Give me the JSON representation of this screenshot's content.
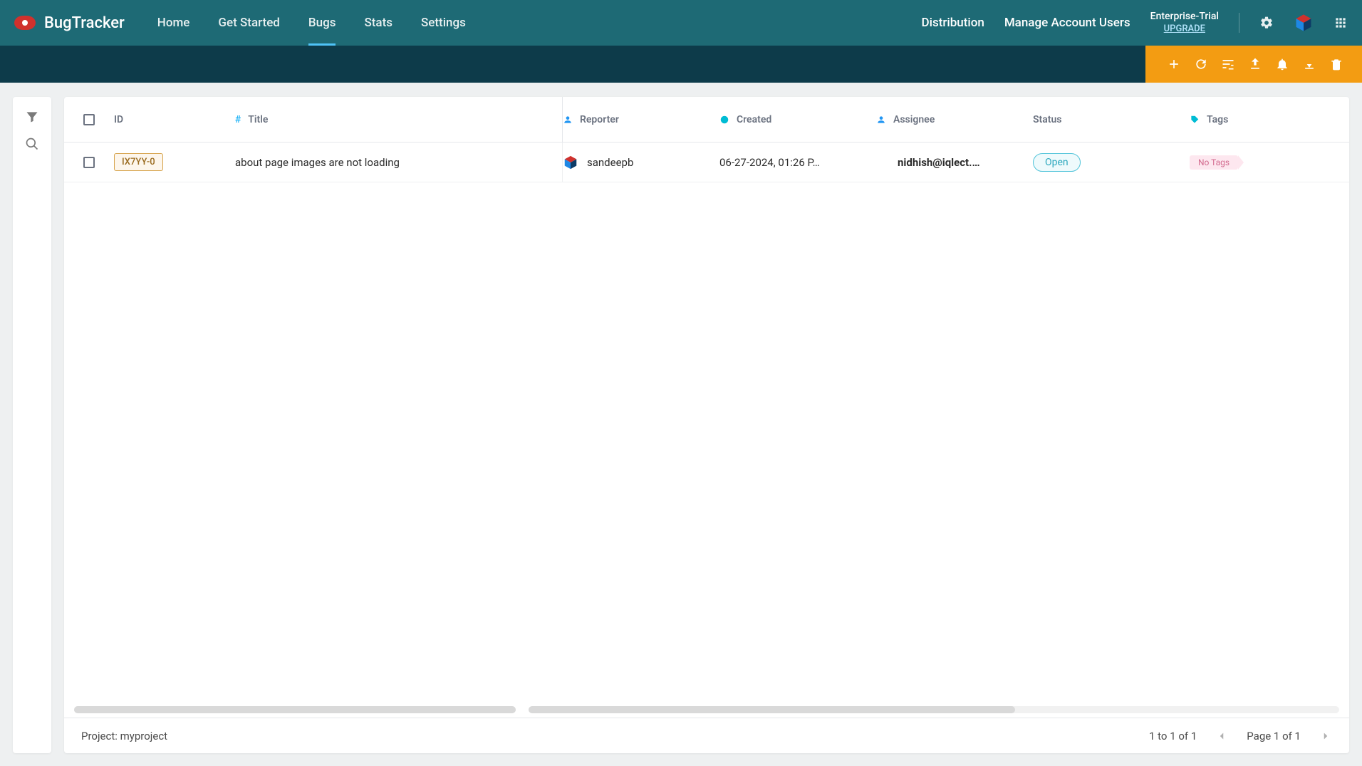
{
  "brand": "BugTracker",
  "nav": {
    "items": [
      {
        "label": "Home",
        "active": false
      },
      {
        "label": "Get Started",
        "active": false
      },
      {
        "label": "Bugs",
        "active": true
      },
      {
        "label": "Stats",
        "active": false
      },
      {
        "label": "Settings",
        "active": false
      }
    ],
    "right": {
      "distribution": "Distribution",
      "manage_users": "Manage Account Users",
      "trial_label": "Enterprise-Trial",
      "upgrade": "UPGRADE"
    }
  },
  "columns": {
    "id": "ID",
    "title": "Title",
    "reporter": "Reporter",
    "created": "Created",
    "assignee": "Assignee",
    "status": "Status",
    "tags": "Tags"
  },
  "rows": [
    {
      "id": "IX7YY-0",
      "title": "about page images are not loading",
      "reporter": "sandeepb",
      "created": "06-27-2024, 01:26 P…",
      "assignee": "nidhish@iqlect.…",
      "status": "Open",
      "tags": "No Tags"
    }
  ],
  "footer": {
    "project": "Project: myproject",
    "range": "1 to 1 of 1",
    "page": "Page 1 of 1"
  }
}
